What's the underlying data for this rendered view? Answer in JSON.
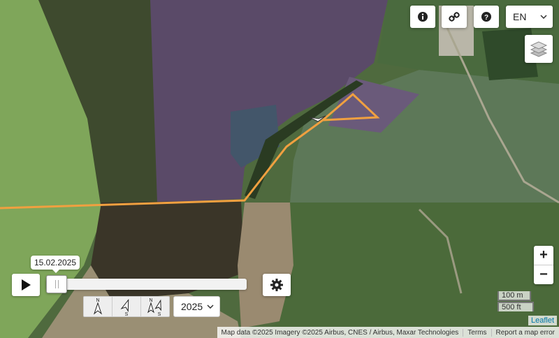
{
  "map": {
    "type": "satellite",
    "track_color": "#f0a040",
    "marker_icon": "bird-arrow-icon"
  },
  "toolbar": {
    "info_icon": "info-icon",
    "link_icon": "link-icon",
    "help_icon": "question-icon",
    "language": "EN",
    "layers_icon": "layers-icon"
  },
  "zoom": {
    "in": "+",
    "out": "−"
  },
  "scale": {
    "metric": "100 m",
    "imperial": "500 ft"
  },
  "attribution": {
    "data": "Map data ©2025 Imagery ©2025 Airbus, CNES / Airbus, Maxar Technologies",
    "terms": "Terms",
    "report": "Report a map error",
    "leaflet": "Leaflet"
  },
  "timeline": {
    "date": "15.02.2025",
    "position": 0,
    "year": "2025",
    "play_icon": "play-icon",
    "settings_icon": "gear-icon"
  },
  "compass": [
    {
      "name": "north-up-icon",
      "labels": [
        "N"
      ]
    },
    {
      "name": "south-up-icon",
      "labels": [
        "S"
      ]
    },
    {
      "name": "north-south-icon",
      "labels": [
        "N",
        "S"
      ]
    }
  ]
}
